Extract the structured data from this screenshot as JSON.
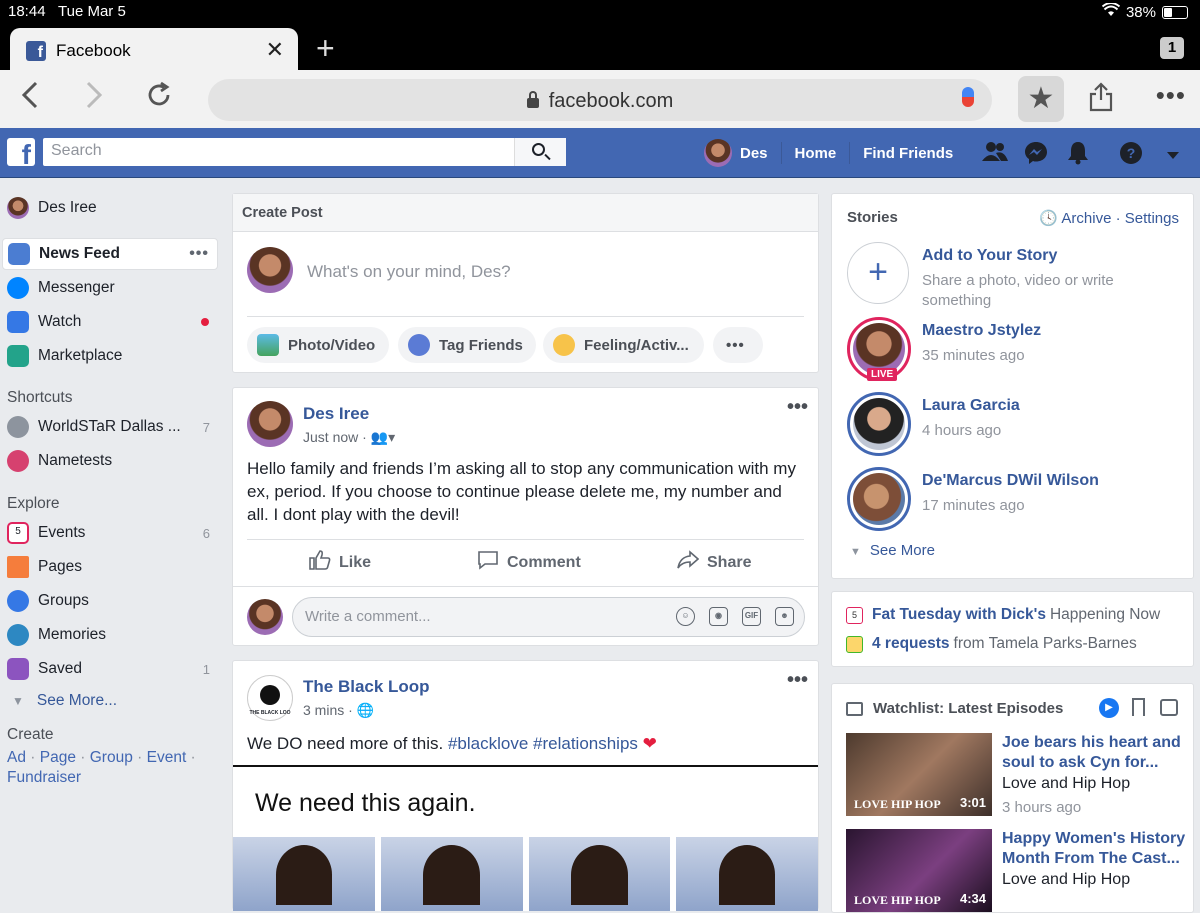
{
  "status": {
    "time": "18:44",
    "date": "Tue Mar 5",
    "battery": "38%",
    "battery_level": 0.38
  },
  "browser": {
    "tab_title": "Facebook",
    "tab_count": "1",
    "url": "facebook.com"
  },
  "fb": {
    "search_placeholder": "Search",
    "user_short": "Des",
    "home": "Home",
    "find_friends": "Find Friends"
  },
  "left": {
    "profile": "Des Iree",
    "items": [
      {
        "label": "News Feed"
      },
      {
        "label": "Messenger"
      },
      {
        "label": "Watch"
      },
      {
        "label": "Marketplace"
      }
    ],
    "shortcuts_header": "Shortcuts",
    "shortcuts": [
      {
        "label": "WorldSTaR Dallas ...",
        "count": "7"
      },
      {
        "label": "Nametests",
        "count": ""
      }
    ],
    "explore_header": "Explore",
    "explore": [
      {
        "label": "Events",
        "count": "6"
      },
      {
        "label": "Pages",
        "count": ""
      },
      {
        "label": "Groups",
        "count": ""
      },
      {
        "label": "Memories",
        "count": ""
      },
      {
        "label": "Saved",
        "count": "1"
      }
    ],
    "see_more": "See More...",
    "create_header": "Create",
    "create_links": [
      "Ad",
      "Page",
      "Group",
      "Event",
      "Fundraiser"
    ]
  },
  "create_post": {
    "header": "Create Post",
    "placeholder": "What's on your mind, Des?",
    "buttons": [
      "Photo/Video",
      "Tag Friends",
      "Feeling/Activ...",
      "•••"
    ]
  },
  "post1": {
    "author": "Des Iree",
    "time": "Just now",
    "text": "Hello family and friends I’m asking all to stop any communication with my ex, period. If you choose to continue please delete me, my number and all. I dont play with the devil!",
    "like": "Like",
    "comment": "Comment",
    "share": "Share",
    "comment_placeholder": "Write a comment..."
  },
  "post2": {
    "author": "The Black Loop",
    "time": "3 mins",
    "text_plain": "We DO need more of this.",
    "tag1": "#blacklove",
    "tag2": "#relationships",
    "image_caption": "We need this again.",
    "logo_text": "THE BLACK LOO"
  },
  "stories": {
    "header": "Stories",
    "archive": "Archive",
    "settings": "Settings",
    "add_title": "Add to Your Story",
    "add_sub": "Share a photo, video or write something",
    "items": [
      {
        "name": "Maestro Jstylez",
        "time": "35 minutes ago",
        "live": "LIVE"
      },
      {
        "name": "Laura Garcia",
        "time": "4 hours ago"
      },
      {
        "name": "De'Marcus DWil Wilson",
        "time": "17 minutes ago"
      }
    ],
    "see_more": "See More"
  },
  "events": {
    "event_name": "Fat Tuesday with Dick's",
    "event_status": "Happening Now",
    "requests": "4 requests",
    "requests_from": "from Tamela Parks-Barnes",
    "cal_day": "5"
  },
  "watchlist": {
    "header": "Watchlist: Latest Episodes",
    "items": [
      {
        "title": "Joe bears his heart and soul to ask Cyn for...",
        "show": "Love and Hip Hop",
        "time": "3 hours ago",
        "duration": "3:01",
        "brand": "LOVE HIP HOP"
      },
      {
        "title": "Happy Women's History Month From The Cast...",
        "show": "Love and Hip Hop",
        "duration": "4:34",
        "brand": "LOVE HIP HOP"
      }
    ]
  },
  "colors": {
    "fb_blue": "#4267b2",
    "link": "#365899",
    "bg": "#e9ebee",
    "notification": "#e41e3f"
  }
}
